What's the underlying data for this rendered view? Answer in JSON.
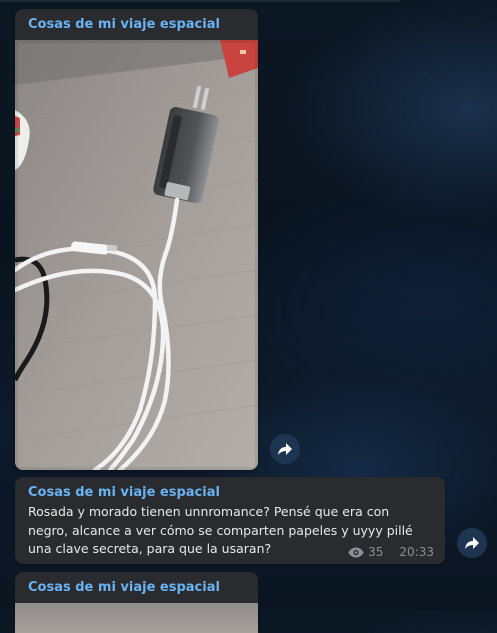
{
  "colors": {
    "background": "#0c1724",
    "bubble": "#2a2b2e",
    "sender": "#6ab3f3",
    "text": "#e9e9e9",
    "meta": "#8b8f94",
    "forward_button": "#1d3550"
  },
  "channel_name": "Cosas de mi viaje espacial",
  "messages": [
    {
      "sender": "Cosas de mi viaje espacial",
      "type": "photo",
      "photo_subject": "phone charger with white USB cable on wooden table"
    },
    {
      "sender": "Cosas de mi viaje espacial",
      "type": "text",
      "text": "Rosada y morado tienen unnromance? Pensé que era con negro, alcance a ver cómo se comparten papeles y uyyy pillé una clave secreta, para que la usaran?",
      "views": "35",
      "time": "20:33",
      "views_icon": "eye-icon"
    },
    {
      "sender": "Cosas de mi viaje espacial",
      "type": "photo"
    }
  ],
  "icons": {
    "forward": "forward-arrow-icon",
    "views": "eye-icon"
  }
}
